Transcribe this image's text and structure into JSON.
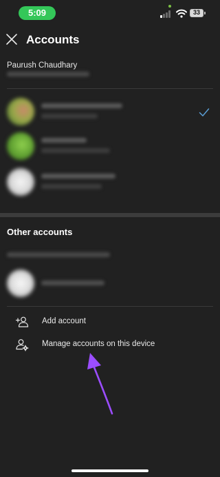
{
  "status": {
    "time": "5:09",
    "battery": "33"
  },
  "header": {
    "title": "Accounts"
  },
  "owner": {
    "name": "Paurush Chaudhary"
  },
  "other_section": {
    "title": "Other accounts"
  },
  "menu": {
    "add_account": "Add account",
    "manage_accounts": "Manage accounts on this device"
  },
  "colors": {
    "background": "#212121",
    "status_pill": "#34c759",
    "check": "#5b9fd6",
    "annotation_arrow": "#9b4dff"
  },
  "icons": [
    "close-icon",
    "checkmark-icon",
    "add-person-icon",
    "manage-person-icon",
    "wifi-icon",
    "signal-icon",
    "battery-icon"
  ]
}
